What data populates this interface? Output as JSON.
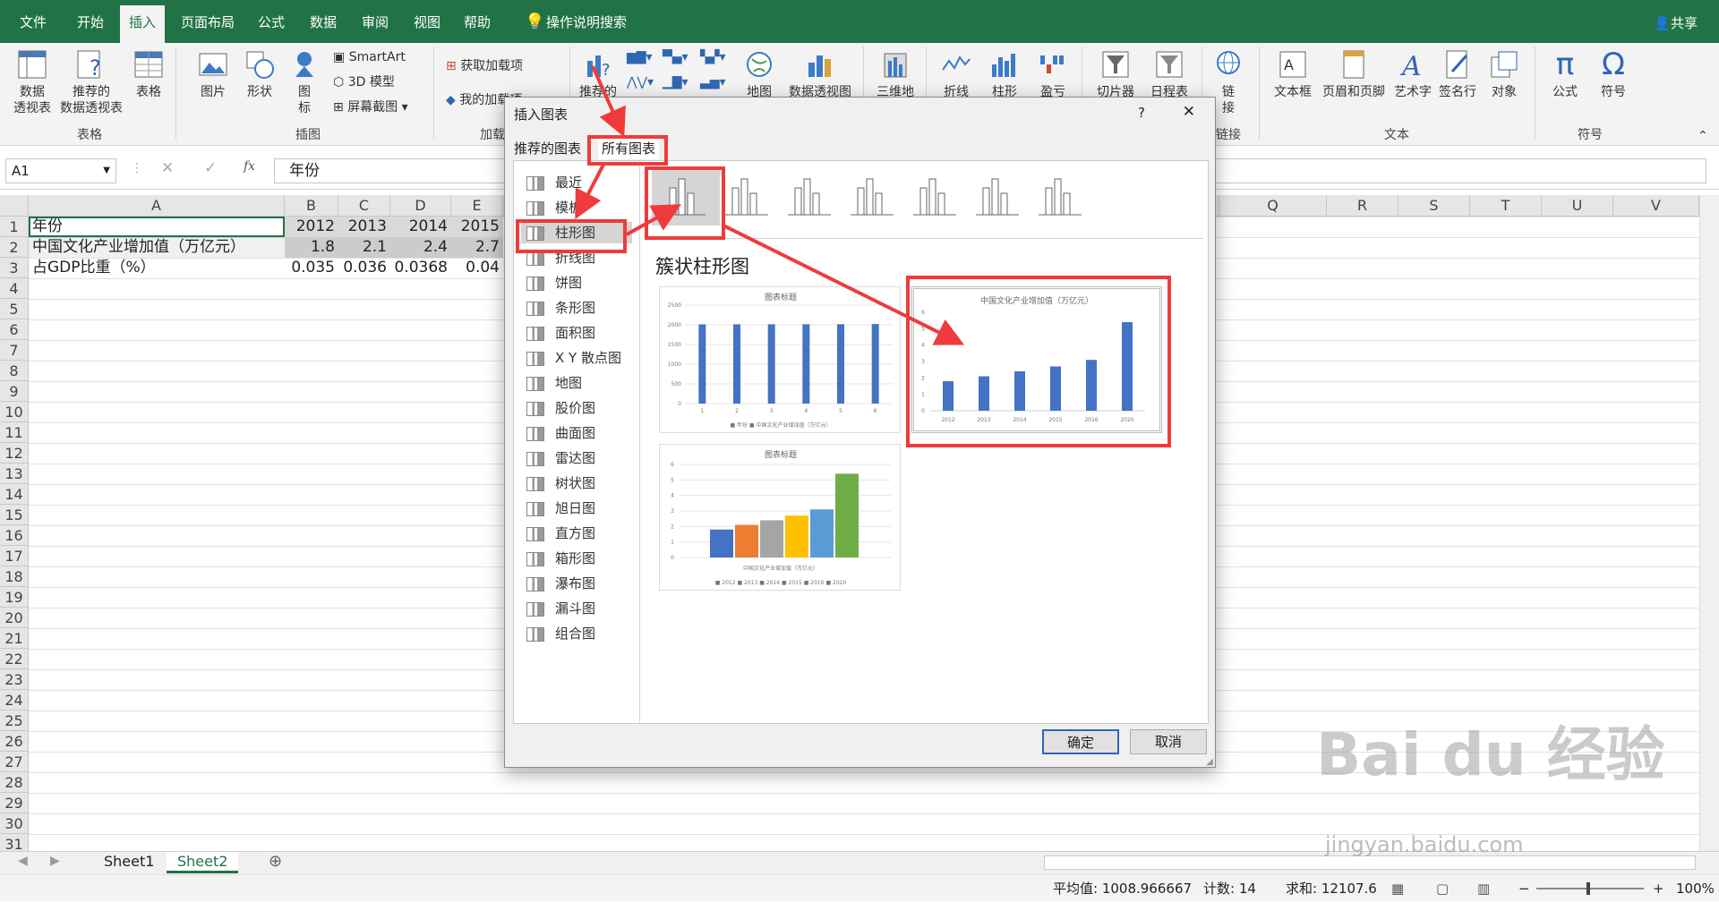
{
  "ribbon_tabs": [
    "文件",
    "开始",
    "插入",
    "页面布局",
    "公式",
    "数据",
    "审阅",
    "视图",
    "帮助",
    "操作说明搜索"
  ],
  "share": "共享",
  "ribbon": {
    "pivot": "数据\n透视表",
    "rec_pivot": "推荐的\n数据透视表",
    "table": "表格",
    "grp_table": "表格",
    "pictures": "图片",
    "shapes": "形状",
    "icons": "图\n标",
    "smartart": "SmartArt",
    "model3d": "3D 模型",
    "screenshot": "屏幕截图",
    "grp_illus": "插图",
    "get_addins": "获取加载项",
    "my_addins": "我的加载项",
    "grp_addins": "加载",
    "rec_charts": "推荐的",
    "maps": "地图",
    "pivot_chart": "数据透视图",
    "map3d": "三维地",
    "spark_line": "折线",
    "spark_col": "柱形",
    "spark_wl": "盈亏",
    "slicer": "切片器",
    "timeline": "日程表",
    "link": "链\n接",
    "grp_link": "链接",
    "textbox": "文本框",
    "headerfooter": "页眉和页脚",
    "wordart": "艺术字",
    "sigline": "签名行",
    "object": "对象",
    "grp_text": "文本",
    "equation": "公式",
    "symbol": "符号",
    "grp_symbols": "符号"
  },
  "formula_bar": {
    "namebox": "A1",
    "fx": "fx",
    "content": "年份"
  },
  "columns": [
    "A",
    "B",
    "C",
    "D",
    "E",
    "Q",
    "R",
    "S",
    "T",
    "U",
    "V"
  ],
  "rows": [
    "1",
    "2",
    "3",
    "4",
    "5",
    "6",
    "7",
    "8",
    "9",
    "10",
    "11",
    "12",
    "13",
    "14",
    "15",
    "16",
    "17",
    "18",
    "19",
    "20",
    "21",
    "22",
    "23",
    "24",
    "25",
    "26",
    "27",
    "28",
    "29",
    "30",
    "31"
  ],
  "cells": {
    "r1": {
      "a": "年份",
      "b": "2012",
      "c": "2013",
      "d": "2014",
      "e": "2015"
    },
    "r2": {
      "a": "中国文化产业增加值（万亿元）",
      "b": "1.8",
      "c": "2.1",
      "d": "2.4",
      "e": "2.7"
    },
    "r3": {
      "a": "占GDP比重（%）",
      "b": "0.035",
      "c": "0.036",
      "d": "0.0368",
      "e": "0.04"
    }
  },
  "sheets": [
    "Sheet1",
    "Sheet2"
  ],
  "status": {
    "average": "平均值: 1008.966667",
    "count": "计数: 14",
    "sum": "求和: 12107.6",
    "zoom": "100%"
  },
  "dialog": {
    "title": "插入图表",
    "help": "?",
    "close": "✕",
    "tab_recommended": "推荐的图表",
    "tab_all": "所有图表",
    "categories": [
      "最近",
      "模板",
      "柱形图",
      "折线图",
      "饼图",
      "条形图",
      "面积图",
      "X Y 散点图",
      "地图",
      "股价图",
      "曲面图",
      "雷达图",
      "树状图",
      "旭日图",
      "直方图",
      "箱形图",
      "瀑布图",
      "漏斗图",
      "组合图"
    ],
    "subtype_title": "簇状柱形图",
    "ok": "确定",
    "cancel": "取消",
    "preview1": {
      "title": "图表标题",
      "legend": [
        "年份",
        "中国文化产业增加值（万亿元）"
      ]
    },
    "preview2": {
      "title": "中国文化产业增加值（万亿元）"
    },
    "preview3": {
      "title": "图表标题",
      "legend": [
        "2012",
        "2013",
        "2014",
        "2015",
        "2016",
        "2020"
      ],
      "xlabel": "中国文化产业增加值（万亿元）"
    }
  },
  "chart_data": [
    {
      "type": "bar",
      "title": "图表标题",
      "categories": [
        "1",
        "2",
        "3",
        "4",
        "5",
        "6"
      ],
      "series": [
        {
          "name": "年份",
          "values": [
            2012,
            2013,
            2014,
            2015,
            2016,
            2020
          ]
        },
        {
          "name": "中国文化产业增加值（万亿元）",
          "values": [
            1.8,
            2.1,
            2.4,
            2.7,
            3.1,
            5.4
          ]
        }
      ],
      "ylim": [
        0,
        2500
      ],
      "yticks": [
        "2500",
        "2000",
        "1500",
        "1000",
        "500",
        "0"
      ]
    },
    {
      "type": "bar",
      "title": "中国文化产业增加值（万亿元）",
      "categories": [
        "2012",
        "2013",
        "2014",
        "2015",
        "2016",
        "2020"
      ],
      "values": [
        1.8,
        2.1,
        2.4,
        2.7,
        3.1,
        5.4
      ],
      "ylim": [
        0,
        6
      ],
      "yticks": [
        "6",
        "5",
        "4",
        "3",
        "2",
        "1",
        "0"
      ]
    },
    {
      "type": "bar",
      "title": "图表标题",
      "categories": [
        "中国文化产业增加值（万亿元）"
      ],
      "series": [
        {
          "name": "2012",
          "values": [
            1.8
          ]
        },
        {
          "name": "2013",
          "values": [
            2.1
          ]
        },
        {
          "name": "2014",
          "values": [
            2.4
          ]
        },
        {
          "name": "2015",
          "values": [
            2.7
          ]
        },
        {
          "name": "2016",
          "values": [
            3.1
          ]
        },
        {
          "name": "2020",
          "values": [
            5.4
          ]
        }
      ],
      "ylim": [
        0,
        6
      ],
      "yticks": [
        "6",
        "5",
        "4",
        "3",
        "2",
        "1",
        "0"
      ]
    }
  ],
  "watermark": {
    "brand": "Bai du 经验",
    "url": "jingyan.baidu.com"
  }
}
